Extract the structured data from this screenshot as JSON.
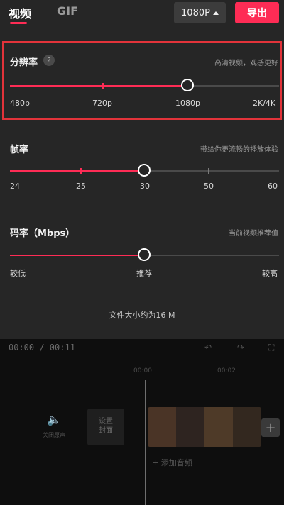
{
  "tabs": {
    "video": "视频",
    "gif": "GIF"
  },
  "resolution_button": {
    "label": "1080P"
  },
  "export_button": {
    "label": "导出"
  },
  "resolution": {
    "title": "分辨率",
    "help": "?",
    "hint": "高清视频，观感更好",
    "labels": [
      "480p",
      "720p",
      "1080p",
      "2K/4K"
    ],
    "selected": "1080p"
  },
  "frame_rate": {
    "title": "帧率",
    "hint": "带给你更流畅的播放体验",
    "labels": [
      "24",
      "25",
      "30",
      "50",
      "60"
    ],
    "selected": "30"
  },
  "bitrate": {
    "title": "码率（Mbps）",
    "hint": "当前视频推荐值",
    "labels": [
      "较低",
      "推荐",
      "较高"
    ],
    "selected": "推荐"
  },
  "file_size": "文件大小约为16 M",
  "editor": {
    "time_current": "00:00",
    "time_total": "/ 00:11",
    "ruler": [
      "00:00",
      "00:02"
    ],
    "mute_label": "关闭原声",
    "cover_label_1": "设置",
    "cover_label_2": "封面",
    "add_audio": "+ 添加音频",
    "add_clip": "+"
  },
  "colors": {
    "accent": "#fe2c55",
    "panel": "#262626",
    "track": "#4a4a4a"
  }
}
